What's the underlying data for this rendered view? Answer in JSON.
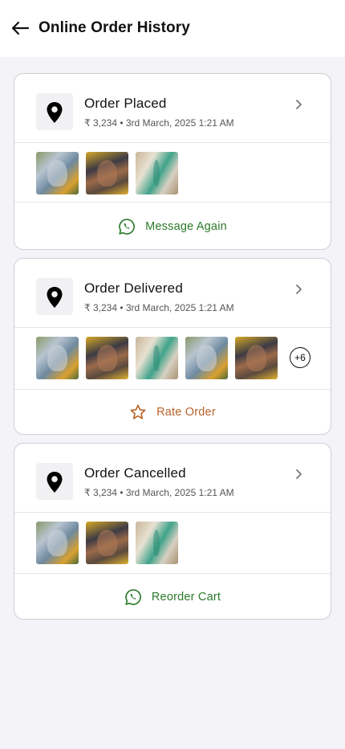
{
  "header": {
    "title": "Online Order History",
    "back_icon": "arrow-left-icon"
  },
  "orders": [
    {
      "status": "Order Placed",
      "meta": "₹ 3,234 • 3rd March, 2025 1:21 AM",
      "thumbnails": [
        "thumb-a",
        "thumb-b",
        "thumb-c"
      ],
      "more_count": "",
      "action": {
        "label": "Message Again",
        "icon": "whatsapp-icon",
        "color": "#2b7a2b"
      }
    },
    {
      "status": "Order Delivered",
      "meta": "₹ 3,234 • 3rd March, 2025 1:21 AM",
      "thumbnails": [
        "thumb-a",
        "thumb-b",
        "thumb-c",
        "thumb-a",
        "thumb-b"
      ],
      "more_count": "+6",
      "action": {
        "label": "Rate Order",
        "icon": "star-icon",
        "color": "#b8642a"
      }
    },
    {
      "status": "Order Cancelled",
      "meta": "₹ 3,234 • 3rd March, 2025 1:21 AM",
      "thumbnails": [
        "thumb-a",
        "thumb-b",
        "thumb-c"
      ],
      "more_count": "",
      "action": {
        "label": "Reorder Cart",
        "icon": "whatsapp-icon",
        "color": "#2b7a2b"
      }
    }
  ],
  "colors": {
    "page_bg": "#f4f4f8",
    "card_border": "#cfcfd4",
    "accent_green": "#2b7a2b",
    "accent_orange": "#b8642a"
  }
}
